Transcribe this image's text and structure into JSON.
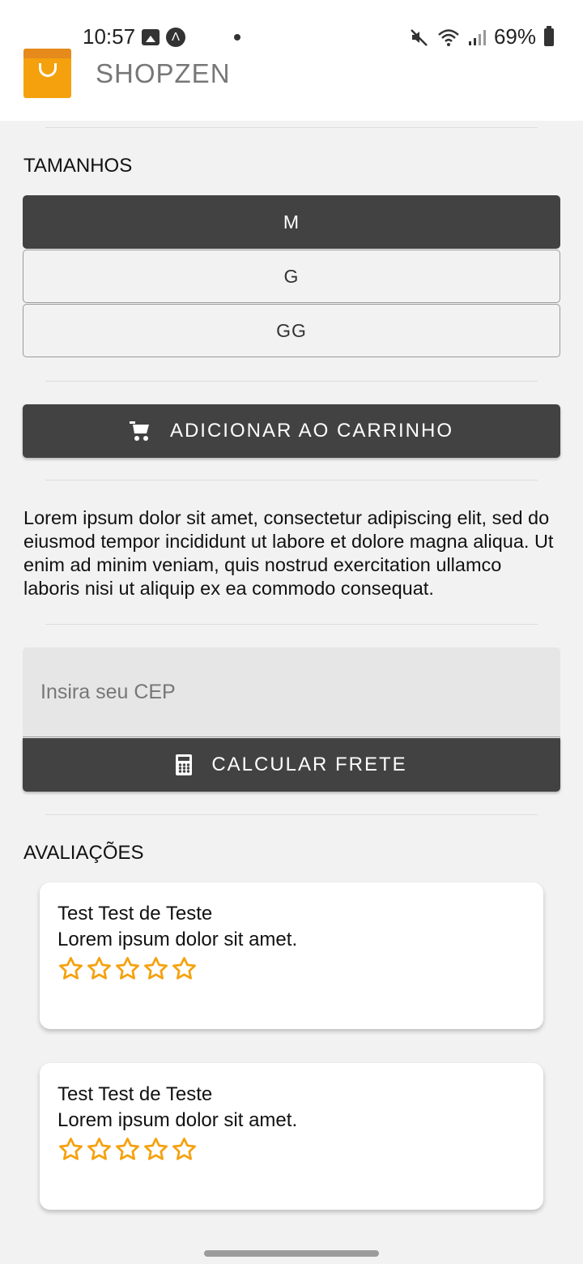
{
  "status_bar": {
    "time": "10:57",
    "battery": "69%"
  },
  "header": {
    "brand": "SHOPZEN"
  },
  "sizes": {
    "title": "TAMANHOS",
    "options": [
      "M",
      "G",
      "GG"
    ],
    "selected": "M"
  },
  "add_to_cart": {
    "label": "ADICIONAR AO CARRINHO",
    "icon": "cart-icon"
  },
  "description": "Lorem ipsum dolor sit amet, consectetur adipiscing elit, sed do eiusmod tempor incididunt ut labore et dolore magna aliqua. Ut enim ad minim veniam, quis nostrud exercitation ullamco laboris nisi ut aliquip ex ea commodo consequat.",
  "shipping": {
    "cep_placeholder": "Insira seu CEP",
    "cep_value": "",
    "button_label": "CALCULAR FRETE",
    "icon": "calculator-icon"
  },
  "reviews": {
    "title": "AVALIAÇÕES",
    "items": [
      {
        "name": "Test Test de Teste",
        "text": "Lorem ipsum dolor sit amet.",
        "rating": 0,
        "max_rating": 5
      },
      {
        "name": "Test Test de Teste",
        "text": "Lorem ipsum dolor sit amet.",
        "rating": 0,
        "max_rating": 5
      }
    ]
  },
  "colors": {
    "accent": "#f5a10e",
    "dark_button": "#424242",
    "star": "#f5a10e"
  }
}
